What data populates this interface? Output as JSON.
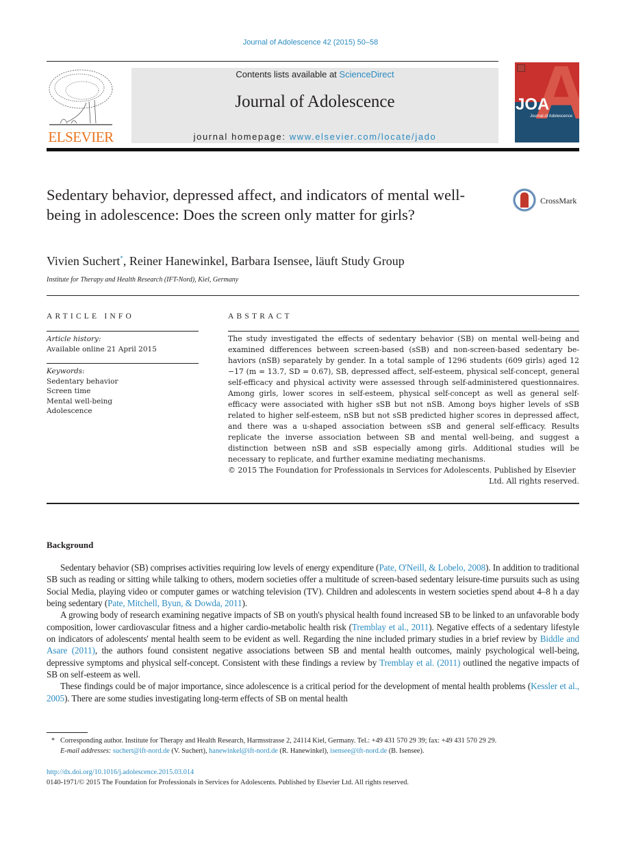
{
  "header": {
    "journal_citation": "Journal of Adolescence 42 (2015) 50–58",
    "publisher_logo_text": "ELSEVIER",
    "contents_prefix": "Contents lists available at ",
    "contents_link": "ScienceDirect",
    "journal_title": "Journal of Adolescence",
    "homepage_prefix": "journal homepage: ",
    "homepage_link": "www.elsevier.com/locate/jado",
    "cover": {
      "logo_letters": "JOA",
      "subtitle": "Journal of Adolescence",
      "colors": {
        "top": "#c8312d",
        "bottom": "#1f4f73"
      }
    }
  },
  "article": {
    "title": "Sedentary behavior, depressed affect, and indicators of mental well-being in adolescence: Does the screen only matter for girls?",
    "crossmark_label": "CrossMark",
    "authors": [
      {
        "name": "Vivien Suchert",
        "marker": "*"
      },
      {
        "name": "Reiner Hanewinkel"
      },
      {
        "name": "Barbara Isensee"
      },
      {
        "name": "läuft Study Group"
      }
    ],
    "affiliation": "Institute for Therapy and Health Research (IFT-Nord), Kiel, Germany"
  },
  "article_info": {
    "label": "ARTICLE INFO",
    "history_label": "Article history:",
    "history_value": "Available online 21 April 2015",
    "keywords_label": "Keywords:",
    "keywords": [
      "Sedentary behavior",
      "Screen time",
      "Mental well-being",
      "Adolescence"
    ]
  },
  "abstract": {
    "label": "ABSTRACT",
    "text": "The study investigated the effects of sedentary behavior (SB) on mental well-being and examined differences between screen-based (sSB) and non-screen-based sedentary be-haviors (nSB) separately by gender. In a total sample of 1296 students (609 girls) aged 12 −17 (m = 13.7, SD = 0.67), SB, depressed affect, self-esteem, physical self-concept, general self-efficacy and physical activity were assessed through self-administered questionnaires. Among girls, lower scores in self-esteem, physical self-concept as well as general self-efficacy were associated with higher sSB but not nSB. Among boys higher levels of sSB related to higher self-esteem, nSB but not sSB predicted higher scores in depressed affect, and there was a u-shaped association between sSB and general self-efficacy. Results replicate the inverse association between SB and mental well-being, and suggest a distinction between nSB and sSB especially among girls. Additional studies will be necessary to replicate, and further examine mediating mechanisms.",
    "copyright_line1": "© 2015 The Foundation for Professionals in Services for Adolescents. Published by Elsevier",
    "copyright_line2": "Ltd. All rights reserved."
  },
  "body": {
    "section_heading": "Background",
    "paragraphs": [
      {
        "parts": [
          {
            "t": "Sedentary behavior (SB) comprises activities requiring low levels of energy expenditure ("
          },
          {
            "link": "Pate, O'Neill, & Lobelo, 2008"
          },
          {
            "t": "). In addition to traditional SB such as reading or sitting while talking to others, modern societies offer a multitude of screen-based sedentary leisure-time pursuits such as using Social Media, playing video or computer games or watching television (TV). Children and adolescents in western societies spend about 4–8 h a day being sedentary ("
          },
          {
            "link": "Pate, Mitchell, Byun, & Dowda, 2011"
          },
          {
            "t": ")."
          }
        ]
      },
      {
        "parts": [
          {
            "t": "A growing body of research examining negative impacts of SB on youth's physical health found increased SB to be linked to an unfavorable body composition, lower cardiovascular fitness and a higher cardio-metabolic health risk ("
          },
          {
            "link": "Tremblay et al., 2011"
          },
          {
            "t": "). Negative effects of a sedentary lifestyle on indicators of adolescents' mental health seem to be evident as well. Regarding the nine included primary studies in a brief review by "
          },
          {
            "link": "Biddle and Asare (2011)"
          },
          {
            "t": ", the authors found consistent negative associations between SB and mental health outcomes, mainly psychological well-being, depressive symptoms and physical self-concept. Consistent with these findings a review by "
          },
          {
            "link": "Tremblay et al. (2011)"
          },
          {
            "t": " outlined the negative impacts of SB on self-esteem as well."
          }
        ]
      },
      {
        "parts": [
          {
            "t": "These findings could be of major importance, since adolescence is a critical period for the development of mental health problems ("
          },
          {
            "link": "Kessler et al., 2005"
          },
          {
            "t": "). There are some studies investigating long-term effects of SB on mental health"
          }
        ]
      }
    ]
  },
  "footnotes": {
    "marker": "*",
    "corresponding": "Corresponding author. Institute for Therapy and Health Research, Harmsstrasse 2, 24114 Kiel, Germany. Tel.: +49 431 570 29 39; fax: +49 431 570 29 29.",
    "email_label": "E-mail addresses:",
    "emails": [
      {
        "address": "suchert@ift-nord.de",
        "who": " (V. Suchert), "
      },
      {
        "address": "hanewinkel@ift-nord.de",
        "who": " (R. Hanewinkel), "
      },
      {
        "address": "isensee@ift-nord.de",
        "who": " (B. Isensee)."
      }
    ]
  },
  "doi": {
    "link": "http://dx.doi.org/10.1016/j.adolescence.2015.03.014",
    "rights": "0140-1971/© 2015 The Foundation for Professionals in Services for Adolescents. Published by Elsevier Ltd. All rights reserved."
  }
}
